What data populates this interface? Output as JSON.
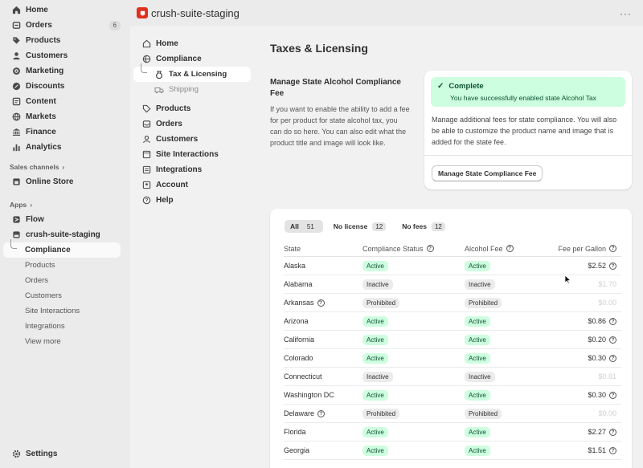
{
  "shop_nav": {
    "items": [
      {
        "label": "Home",
        "icon": "home-icon"
      },
      {
        "label": "Orders",
        "icon": "orders-icon",
        "badge": "6"
      },
      {
        "label": "Products",
        "icon": "tag-icon"
      },
      {
        "label": "Customers",
        "icon": "person-icon"
      },
      {
        "label": "Marketing",
        "icon": "target-icon"
      },
      {
        "label": "Discounts",
        "icon": "discount-icon"
      },
      {
        "label": "Content",
        "icon": "content-icon"
      },
      {
        "label": "Markets",
        "icon": "globe-icon"
      },
      {
        "label": "Finance",
        "icon": "bank-icon"
      },
      {
        "label": "Analytics",
        "icon": "chart-icon"
      }
    ],
    "sales_channels_title": "Sales channels",
    "online_store": "Online Store",
    "apps_title": "Apps",
    "flow": "Flow",
    "app_name": "crush-suite-staging",
    "app_subs": [
      "Compliance",
      "Products",
      "Orders",
      "Customers",
      "Site Interactions",
      "Integrations",
      "View more"
    ],
    "settings": "Settings"
  },
  "topbar": {
    "title": "crush-suite-staging",
    "more": "···"
  },
  "app_nav": {
    "home": "Home",
    "compliance": "Compliance",
    "tax": "Tax & Licensing",
    "shipping": "Shipping",
    "items": [
      "Products",
      "Orders",
      "Customers",
      "Site Interactions",
      "Integrations",
      "Account",
      "Help"
    ]
  },
  "page": {
    "title": "Taxes & Licensing",
    "section_heading": "Manage State Alcohol Compliance Fee",
    "section_desc": "If you want to enable the ability to add a fee for per product for state alcohol tax, you can do so here. You can also edit what the product title and image will look like."
  },
  "card1": {
    "banner_title": "Complete",
    "banner_msg": "You have successfully enabled state Alcohol Tax",
    "desc": "Manage additional fees for state compliance. You will also be able to customize the product name and image that is added for the state fee.",
    "button": "Manage State Compliance Fee"
  },
  "tabs": [
    {
      "label": "All",
      "count": "51"
    },
    {
      "label": "No license",
      "count": "12"
    },
    {
      "label": "No fees",
      "count": "12"
    }
  ],
  "table": {
    "headers": [
      "State",
      "Compliance Status",
      "Alcohol Fee",
      "Fee per Gallon"
    ],
    "rows": [
      {
        "state": "Alaska",
        "status": "Active",
        "fee": "Active",
        "gallon": "$2.52"
      },
      {
        "state": "Alabama",
        "status": "Inactive",
        "fee": "Inactive",
        "gallon": "$1.70"
      },
      {
        "state": "Arkansas",
        "status": "Prohibited",
        "fee": "Prohibited",
        "gallon": "$0.00"
      },
      {
        "state": "Arizona",
        "status": "Active",
        "fee": "Active",
        "gallon": "$0.86"
      },
      {
        "state": "California",
        "status": "Active",
        "fee": "Active",
        "gallon": "$0.20"
      },
      {
        "state": "Colorado",
        "status": "Active",
        "fee": "Active",
        "gallon": "$0.30"
      },
      {
        "state": "Connecticut",
        "status": "Inactive",
        "fee": "Inactive",
        "gallon": "$0.81"
      },
      {
        "state": "Washington DC",
        "status": "Active",
        "fee": "Active",
        "gallon": "$0.30"
      },
      {
        "state": "Delaware",
        "status": "Prohibited",
        "fee": "Prohibited",
        "gallon": "$0.00"
      },
      {
        "state": "Florida",
        "status": "Active",
        "fee": "Active",
        "gallon": "$2.27"
      },
      {
        "state": "Georgia",
        "status": "Active",
        "fee": "Active",
        "gallon": "$1.51"
      }
    ]
  },
  "colors": {
    "active_bg": "#cdfedf",
    "active_text": "#0c5132",
    "brand": "#e0301e"
  }
}
